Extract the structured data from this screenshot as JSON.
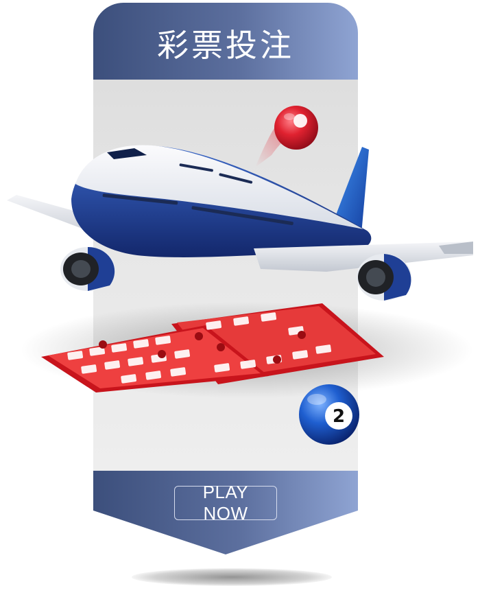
{
  "card": {
    "title": "彩票投注",
    "play_button": "PLAY NOW"
  },
  "decor": {
    "blue_ball_number": "2",
    "colors": {
      "header_dark": "#3c4f7c",
      "header_light": "#8fa4d3",
      "airplane_blue": "#1e3a8a",
      "bingo_red": "#e02424",
      "red_ball": "#d41c2c",
      "blue_ball": "#1d4fb8"
    },
    "icons": [
      "airplane-illustration",
      "bingo-card-illustration",
      "red-lottery-ball-icon",
      "blue-lottery-ball-icon"
    ]
  }
}
